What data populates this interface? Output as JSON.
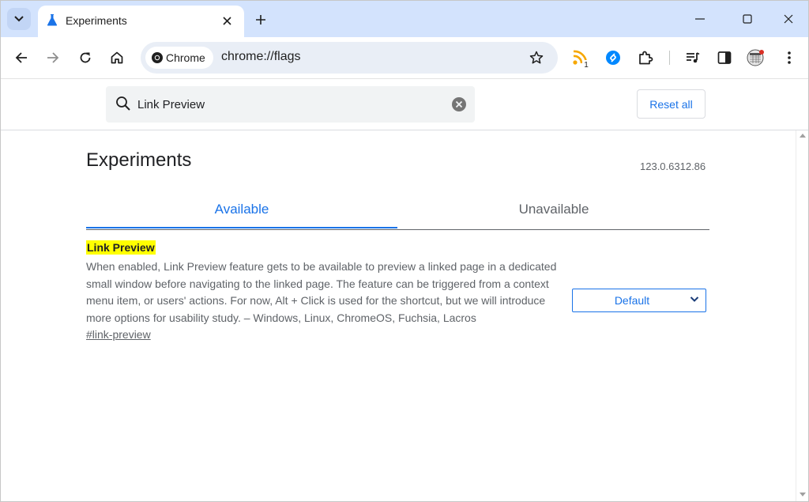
{
  "tab": {
    "title": "Experiments",
    "close_label": "×"
  },
  "toolbar": {
    "chip_label": "Chrome",
    "url": "chrome://flags",
    "rss_badge": "1"
  },
  "flags_header": {
    "search_value": "Link Preview",
    "reset_label": "Reset all"
  },
  "page": {
    "title": "Experiments",
    "version": "123.0.6312.86",
    "tabs": [
      {
        "label": "Available",
        "active": true
      },
      {
        "label": "Unavailable",
        "active": false
      }
    ]
  },
  "flag": {
    "name": "Link Preview",
    "description": "When enabled, Link Preview feature gets to be available to preview a linked page in a dedicated small window before navigating to the linked page. The feature can be triggered from a context menu item, or users' actions. For now, Alt + Click is used for the shortcut, but we will introduce more options for usability study. – Windows, Linux, ChromeOS, Fuchsia, Lacros",
    "link": "#link-preview",
    "selected_option": "Default"
  },
  "colors": {
    "accent": "#1a73e8",
    "tabstrip": "#d3e3fd",
    "highlight": "#ffff00",
    "rss": "#f6a700",
    "shazam": "#0088ff"
  },
  "icons": [
    "tab-search-icon",
    "flask-icon",
    "close-icon",
    "plus-icon",
    "minimize-icon",
    "maximize-icon",
    "window-close-icon",
    "back-arrow-icon",
    "forward-arrow-icon",
    "reload-icon",
    "home-icon",
    "chrome-logo-icon",
    "star-icon",
    "rss-icon",
    "shazam-icon",
    "puzzle-icon",
    "media-control-icon",
    "side-panel-icon",
    "calendar-icon",
    "more-vert-icon",
    "search-icon",
    "clear-icon",
    "chevron-down-icon"
  ]
}
